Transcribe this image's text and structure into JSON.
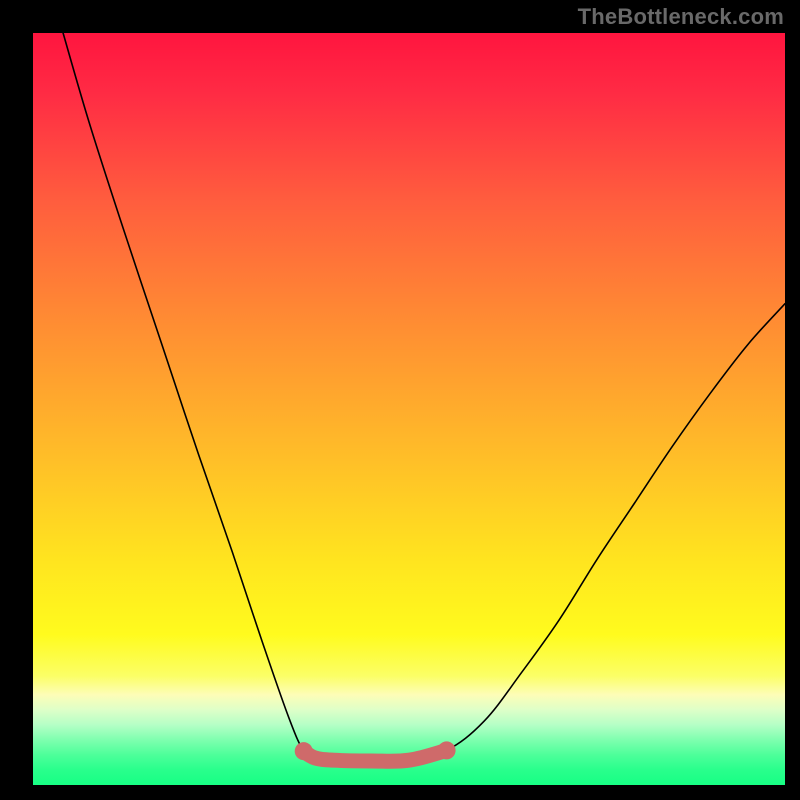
{
  "watermark": "TheBottleneck.com",
  "colors": {
    "curve": "#000000",
    "trough": "#cf6a6a",
    "background_top": "#ff153f",
    "background_bottom": "#17ff84",
    "page_bg": "#000000",
    "watermark": "#696969"
  },
  "chart_data": {
    "type": "line",
    "title": "",
    "xlabel": "",
    "ylabel": "",
    "xlim": [
      0,
      100
    ],
    "ylim": [
      0,
      100
    ],
    "note": "Stylized bottleneck/V-curve on a spectral gradient. Y is mismatch percentage (high=red at top, low=green at bottom). X is an unlabeled configuration axis. Curve is approximate, read from pixels; no numeric axes shown.",
    "series": [
      {
        "name": "bottleneck-curve",
        "x": [
          4,
          7.5,
          12,
          17,
          22,
          26.5,
          30.5,
          34,
          36,
          37.5,
          40,
          45,
          50,
          55,
          60,
          65,
          70,
          75,
          80,
          85,
          90,
          95,
          100
        ],
        "y": [
          100,
          88,
          74,
          59,
          44,
          31,
          19,
          9,
          4.5,
          3.6,
          3.3,
          3.2,
          3.3,
          4.6,
          8.5,
          15,
          22,
          30,
          37.5,
          45,
          52,
          58.5,
          64
        ]
      }
    ],
    "trough": {
      "x_start": 36,
      "x_end": 55,
      "y_level": 3.4
    }
  }
}
